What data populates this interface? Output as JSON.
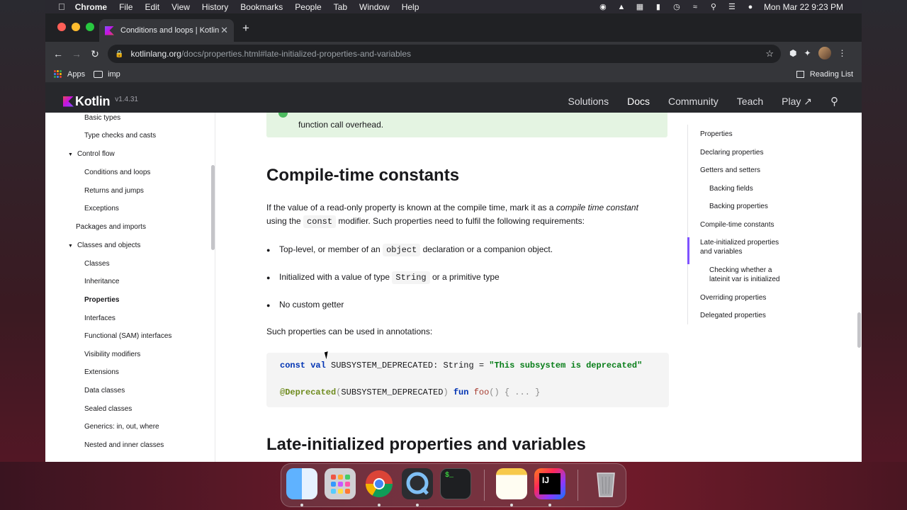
{
  "menubar": {
    "app": "Chrome",
    "items": [
      "File",
      "Edit",
      "View",
      "History",
      "Bookmarks",
      "People",
      "Tab",
      "Window",
      "Help"
    ],
    "clock": "Mon Mar 22  9:23 PM"
  },
  "browser": {
    "tab_title": "Conditions and loops | Kotlin",
    "url_host": "kotlinlang.org",
    "url_path": "/docs/properties.html#late-initialized-properties-and-variables",
    "bookmarks": [
      "Apps",
      "imp"
    ],
    "reading_list": "Reading List"
  },
  "site": {
    "logo": "Kotlin",
    "version": "v1.4.31",
    "nav": [
      "Solutions",
      "Docs",
      "Community",
      "Teach",
      "Play ↗"
    ]
  },
  "sidebar": {
    "items": [
      {
        "label": "Basic types"
      },
      {
        "label": "Type checks and casts"
      },
      {
        "label": "Control flow"
      },
      {
        "label": "Conditions and loops"
      },
      {
        "label": "Returns and jumps"
      },
      {
        "label": "Exceptions"
      },
      {
        "label": "Packages and imports"
      },
      {
        "label": "Classes and objects"
      },
      {
        "label": "Classes"
      },
      {
        "label": "Inheritance"
      },
      {
        "label": "Properties"
      },
      {
        "label": "Interfaces"
      },
      {
        "label": "Functional (SAM) interfaces"
      },
      {
        "label": "Visibility modifiers"
      },
      {
        "label": "Extensions"
      },
      {
        "label": "Data classes"
      },
      {
        "label": "Sealed classes"
      },
      {
        "label": "Generics: in, out, where"
      },
      {
        "label": "Nested and inner classes"
      }
    ]
  },
  "article": {
    "tip_text": "function call overhead.",
    "h_compile": "Compile-time constants",
    "p1_a": "If the value of a read-only property is known at the compile time, mark it as a ",
    "p1_em": "compile time constant",
    "p1_b": "using the ",
    "p1_code": "const",
    "p1_c": " modifier. Such properties need to fulfil the following requirements:",
    "b1_a": "Top-level, or member of an ",
    "b1_code": "object",
    "b1_b": " declaration or a companion object.",
    "b2_a": "Initialized with a value of type ",
    "b2_code": "String",
    "b2_b": " or a primitive type",
    "b3": "No custom getter",
    "p2": "Such properties can be used in annotations:",
    "code1_kw1": "const",
    "code1_kw2": "val",
    "code1_id": "SUBSYSTEM_DEPRECATED",
    "code1_colon": ": String = ",
    "code1_str": "\"This subsystem is deprecated\"",
    "code2_ann": "@Deprecated",
    "code2_p1": "(",
    "code2_id": "SUBSYSTEM_DEPRECATED",
    "code2_p2": ") ",
    "code2_kw": "fun",
    "code2_fn": "foo",
    "code2_rest": "() { ... }",
    "h_late": "Late-initialized properties and variables"
  },
  "toc": {
    "items": [
      {
        "label": "Properties"
      },
      {
        "label": "Declaring properties"
      },
      {
        "label": "Getters and setters"
      },
      {
        "label": "Backing fields"
      },
      {
        "label": "Backing properties"
      },
      {
        "label": "Compile-time constants"
      },
      {
        "label": "Late-initialized properties and variables"
      },
      {
        "label": "Checking whether a lateinit var is initialized"
      },
      {
        "label": "Overriding properties"
      },
      {
        "label": "Delegated properties"
      }
    ]
  },
  "dock": {
    "apps": [
      "Finder",
      "Launchpad",
      "Google Chrome",
      "QuickTime Player",
      "Terminal",
      "Notes",
      "IntelliJ IDEA",
      "Trash"
    ],
    "terminal_prompt": "$_",
    "idea_label": "IJ"
  },
  "colors": {
    "kotlin_purple": "#7f52ff",
    "header_bg": "#27282c",
    "tip_bg": "#e4f4e2"
  }
}
